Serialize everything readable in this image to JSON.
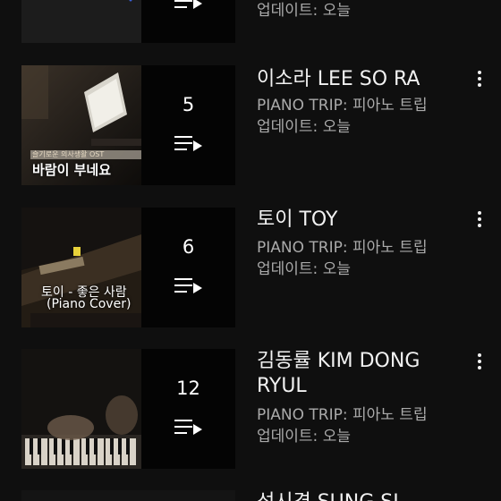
{
  "items": [
    {
      "title": "",
      "channel": "",
      "updated": "업데이트: 오늘",
      "count": "",
      "thumb_caption_small": "",
      "thumb_caption_main": "",
      "thumb_caption_sub": ""
    },
    {
      "title": "이소라 LEE SO RA",
      "channel": "PIANO TRIP: 피아노 트립",
      "updated": "업데이트: 오늘",
      "count": "5",
      "thumb_caption_small": "슬기로운 의사생활 OST",
      "thumb_caption_main": "바람이 부네요",
      "thumb_caption_sub": ""
    },
    {
      "title": "토이 TOY",
      "channel": "PIANO TRIP: 피아노 트립",
      "updated": "업데이트: 오늘",
      "count": "6",
      "thumb_caption_small": "",
      "thumb_caption_main": "토이 - 좋은 사람",
      "thumb_caption_sub": "(Piano Cover)"
    },
    {
      "title": "김동률 KIM DONG RYUL",
      "channel": "PIANO TRIP: 피아노 트립",
      "updated": "업데이트: 오늘",
      "count": "12",
      "thumb_caption_small": "",
      "thumb_caption_main": "",
      "thumb_caption_sub": ""
    },
    {
      "title": "성시경 SUNG SI",
      "channel": "",
      "updated": "",
      "count": "",
      "thumb_caption_small": "",
      "thumb_caption_main": "",
      "thumb_caption_sub": ""
    }
  ],
  "icons": {
    "playlist": "playlist-play-icon",
    "menu": "more-vert-icon"
  },
  "colors": {
    "background": "#0f0f0f",
    "title": "#f1f1f1",
    "meta": "#aaaaaa"
  }
}
